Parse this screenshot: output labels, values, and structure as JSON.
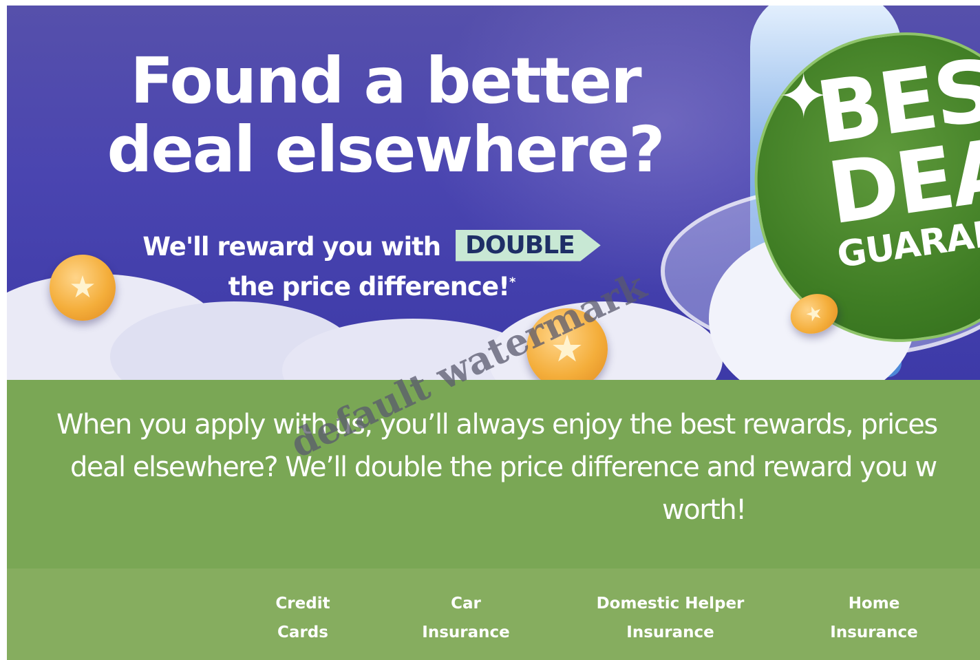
{
  "hero": {
    "title_line1": "Found a better",
    "title_line2": "deal elsewhere?",
    "subtitle_prefix": "We'll reward you with",
    "double_label": "DOUBLE",
    "subtitle_suffix": "the price difference!",
    "asterisk": "*"
  },
  "badge": {
    "line1": "BEST",
    "line2": "DEAL",
    "line3": "GUARANTEE"
  },
  "promo": {
    "line1": "When you apply with us, you’ll always enjoy the best rewards, prices",
    "line2": "deal elsewhere? We’ll double the price difference and reward you w",
    "line3": "worth!"
  },
  "nav": {
    "items": [
      {
        "line1": "Credit",
        "line2": "Cards"
      },
      {
        "line1": "Car",
        "line2": "Insurance"
      },
      {
        "line1": "Domestic Helper",
        "line2": "Insurance"
      },
      {
        "line1": "Home",
        "line2": "Insurance"
      }
    ]
  },
  "watermark": "default watermark",
  "colors": {
    "hero_bg": "#4a45b0",
    "double_bg": "#c8e8d4",
    "band_green": "#7aa755",
    "nav_green": "#86ad5f",
    "badge_green": "#3f7d24",
    "coin": "#f4ae3b"
  },
  "icons": [
    "coin-star-icon",
    "sparkle-icon"
  ]
}
